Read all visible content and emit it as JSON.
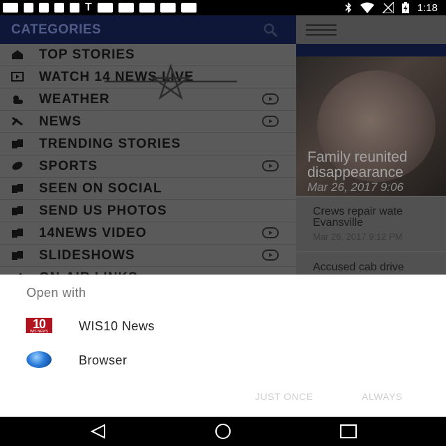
{
  "status_bar": {
    "time": "1:18",
    "text_icon": "T",
    "left_icons": [
      "keyboard-icon",
      "send-icon",
      "facebook-icon",
      "figure-icon",
      "message-icon",
      "square-icon",
      "square-icon",
      "square-icon",
      "square-icon",
      "square-icon"
    ],
    "right_icons": [
      "bluetooth-icon",
      "wifi-icon",
      "no-signal-icon",
      "battery-charging-icon"
    ]
  },
  "drawer": {
    "title": "CATEGORIES",
    "items": [
      {
        "label": "TOP STORIES",
        "icon": "home-icon",
        "has_arrow": false
      },
      {
        "label": "WATCH 14 NEWS LIVE",
        "icon": "video-icon",
        "has_arrow": false
      },
      {
        "label": "WEATHER",
        "icon": "weather-icon",
        "has_arrow": true
      },
      {
        "label": "NEWS",
        "icon": "news-icon",
        "has_arrow": true
      },
      {
        "label": "TRENDING STORIES",
        "icon": "folder-icon",
        "has_arrow": false
      },
      {
        "label": "SPORTS",
        "icon": "football-icon",
        "has_arrow": true
      },
      {
        "label": "SEEN ON SOCIAL",
        "icon": "folder-icon",
        "has_arrow": false
      },
      {
        "label": "SEND US PHOTOS",
        "icon": "folder-icon",
        "has_arrow": false
      },
      {
        "label": "14NEWS VIDEO",
        "icon": "folder-icon",
        "has_arrow": true
      },
      {
        "label": "SLIDESHOWS",
        "icon": "folder-icon",
        "has_arrow": true
      },
      {
        "label": "ON-AIR LINKS",
        "icon": "link-icon",
        "has_arrow": false
      }
    ]
  },
  "content": {
    "hero": {
      "title_line1": "Family reunited",
      "title_line2": "disappearance",
      "date": "Mar 26, 2017 9:06"
    },
    "stories": [
      {
        "title_line1": "Crews repair wate",
        "title_line2": "Evansville",
        "date": "Mar 26, 2017 9:12 PM"
      },
      {
        "title_line1": "Accused cab drive",
        "title_line2": "",
        "date": ""
      }
    ]
  },
  "open_with": {
    "title": "Open with",
    "apps": [
      {
        "label": "WIS10 News",
        "icon": "wis10-logo-icon",
        "logo_text": "10",
        "logo_subtext": "WIS NEWS"
      },
      {
        "label": "Browser",
        "icon": "globe-icon"
      }
    ],
    "buttons": {
      "just_once": "JUST ONCE",
      "always": "ALWAYS"
    }
  },
  "nav_bar": {
    "icons": [
      "back-icon",
      "home-icon",
      "recents-icon"
    ]
  },
  "colors": {
    "drawer_header": "#0e1738",
    "sheet_bg": "#ffffff",
    "scrim_text": "#111111",
    "wis_red": "#b3121f"
  }
}
